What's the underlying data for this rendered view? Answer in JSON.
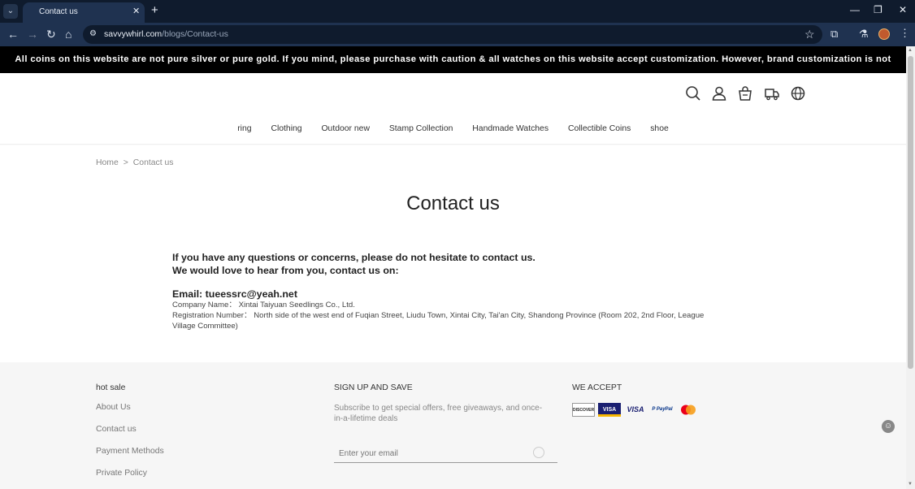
{
  "browser": {
    "tab_title": "Contact us",
    "url_domain": "savvywhirl.com",
    "url_path": "/blogs/Contact-us"
  },
  "site": {
    "announcement": "All coins on this website are not pure silver or pure gold. If you mind, please purchase with caution & all watches on this website accept customization. However, brand customization is not accepted.",
    "menu": [
      "ring",
      "Clothing",
      "Outdoor new",
      "Stamp Collection",
      "Handmade Watches",
      "Collectible Coins",
      "shoe"
    ],
    "breadcrumb": {
      "home": "Home",
      "sep": ">",
      "current": "Contact us"
    },
    "title": "Contact us",
    "content": {
      "line1": "If you have any questions or concerns, please do not hesitate to contact us.",
      "line2": "We would love to hear from you, contact us on:",
      "email": "Email: tueessrc@yeah.net",
      "company": "Company Name： Xintai Taiyuan Seedlings Co., Ltd.",
      "registration": "Registration Number： North side of the west end of Fuqian Street, Liudu Town, Xintai City, Tai'an City, Shandong Province (Room 202, 2nd Floor, League Village Committee)"
    },
    "footer": {
      "col1_title": "hot sale",
      "col1_links": [
        "About Us",
        "Contact us",
        "Payment Methods",
        "Private Policy"
      ],
      "col2_title": "SIGN UP AND SAVE",
      "col2_text": "Subscribe to get special offers, free giveaways, and once-in-a-lifetime deals",
      "col2_placeholder": "Enter your email",
      "col3_title": "WE ACCEPT",
      "cards": [
        "DISCOVER",
        "VISA",
        "VISA",
        "P PayPal",
        "mastercard"
      ]
    }
  },
  "colors": {
    "announcement_bg": "#000000",
    "footer_bg": "#f6f6f6",
    "chrome_bg": "#1f3250"
  }
}
